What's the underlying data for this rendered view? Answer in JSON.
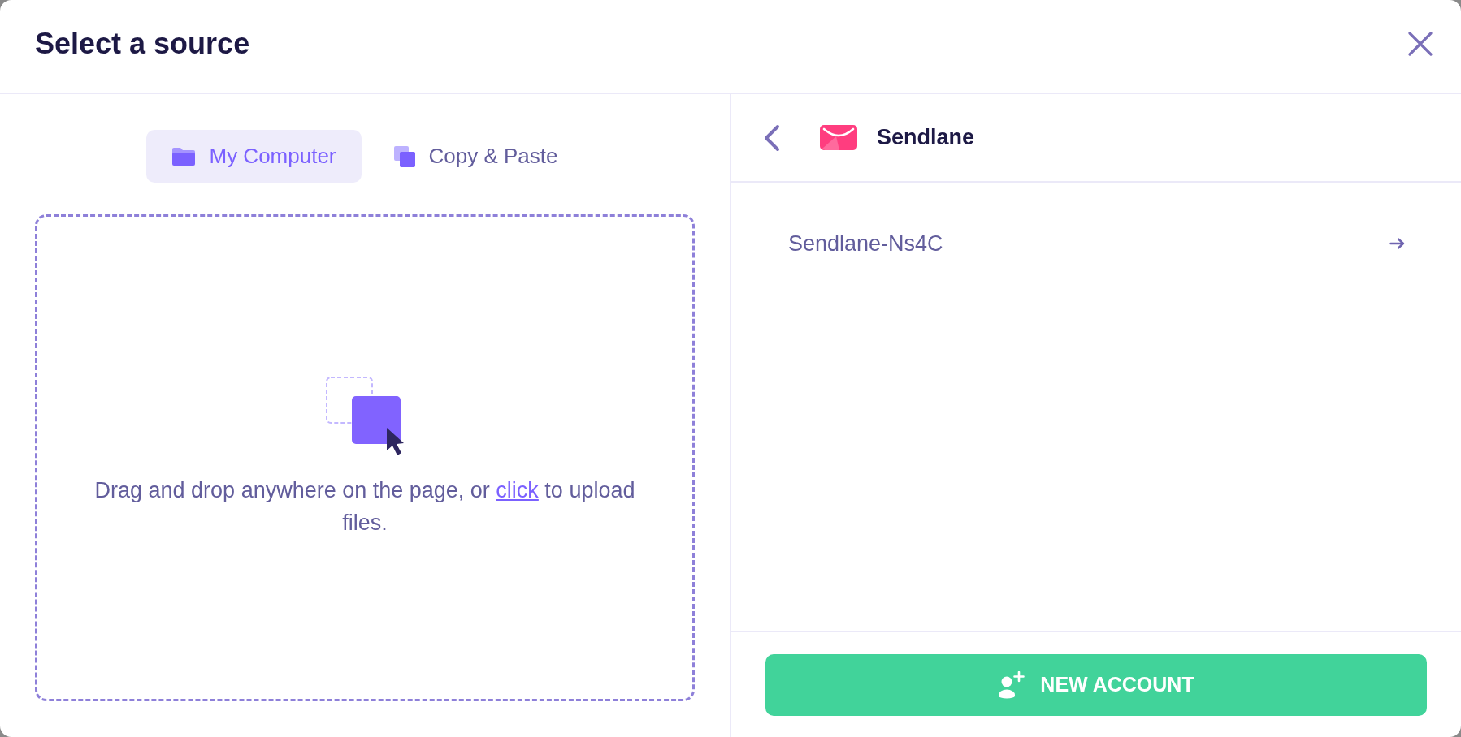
{
  "dialog": {
    "title": "Select a source"
  },
  "tabs": [
    {
      "label": "My Computer",
      "selected": true
    },
    {
      "label": "Copy & Paste",
      "selected": false
    }
  ],
  "dropzone": {
    "text_before": "Drag and drop anywhere on the page, or",
    "link": "click",
    "text_after": "to upload files."
  },
  "source": {
    "name": "Sendlane"
  },
  "accounts": [
    {
      "name": "Sendlane-Ns4C"
    }
  ],
  "new_account_button": {
    "label": "NEW ACCOUNT"
  }
}
